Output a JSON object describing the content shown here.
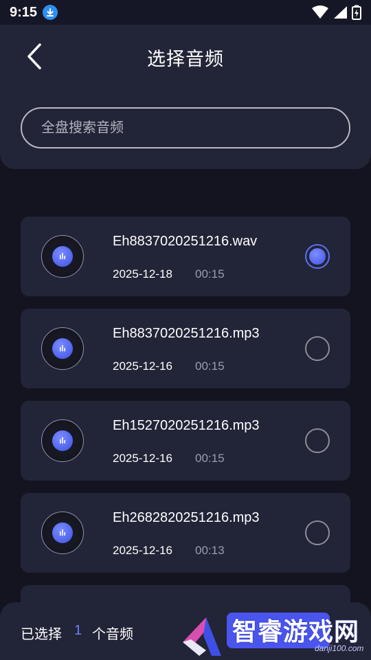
{
  "status_bar": {
    "time": "9:15",
    "icons": [
      "download-icon",
      "wifi-icon",
      "signal-icon",
      "battery-charging-icon"
    ]
  },
  "header": {
    "title": "选择音频",
    "back_icon": "chevron-left-icon"
  },
  "search": {
    "placeholder": "全盘搜索音频",
    "value": ""
  },
  "files": [
    {
      "name": "Eh8837020251216.wav",
      "date": "2025-12-18",
      "duration": "00:15",
      "selected": true
    },
    {
      "name": "Eh8837020251216.mp3",
      "date": "2025-12-16",
      "duration": "00:15",
      "selected": false
    },
    {
      "name": "Eh1527020251216.mp3",
      "date": "2025-12-16",
      "duration": "00:15",
      "selected": false
    },
    {
      "name": "Eh2682820251216.mp3",
      "date": "2025-12-16",
      "duration": "00:13",
      "selected": false
    }
  ],
  "bottom": {
    "selected_label": "已选择",
    "selected_count": "1",
    "selected_unit": "个音频"
  },
  "watermark": {
    "text": "智睿游戏网",
    "sub": "danji100.com"
  },
  "colors": {
    "background": "#13141f",
    "panel": "#222437",
    "accent": "#5b72f6",
    "muted_text": "#9a9cb0"
  }
}
